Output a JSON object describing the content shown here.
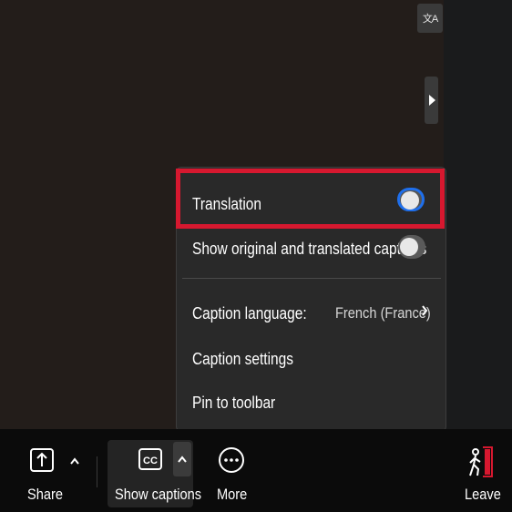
{
  "top_controls": {
    "translate_icon": "translate-icon",
    "translate_glyph": "文A",
    "collapse_icon": "chevron-right-icon"
  },
  "caption_menu": {
    "translation_label": "Translation",
    "translation_on": true,
    "show_original_label": "Show original and translated captions",
    "show_original_on": false,
    "caption_language_label": "Caption language:",
    "caption_language_value": "French (France)",
    "caption_settings_label": "Caption settings",
    "pin_label": "Pin to toolbar"
  },
  "toolbar": {
    "share_label": "Share",
    "show_captions_label": "Show captions",
    "more_label": "More",
    "leave_label": "Leave"
  },
  "colors": {
    "highlight": "#d6182f",
    "toggle_accent": "#1f6feb",
    "leave_accent": "#d6182f"
  }
}
